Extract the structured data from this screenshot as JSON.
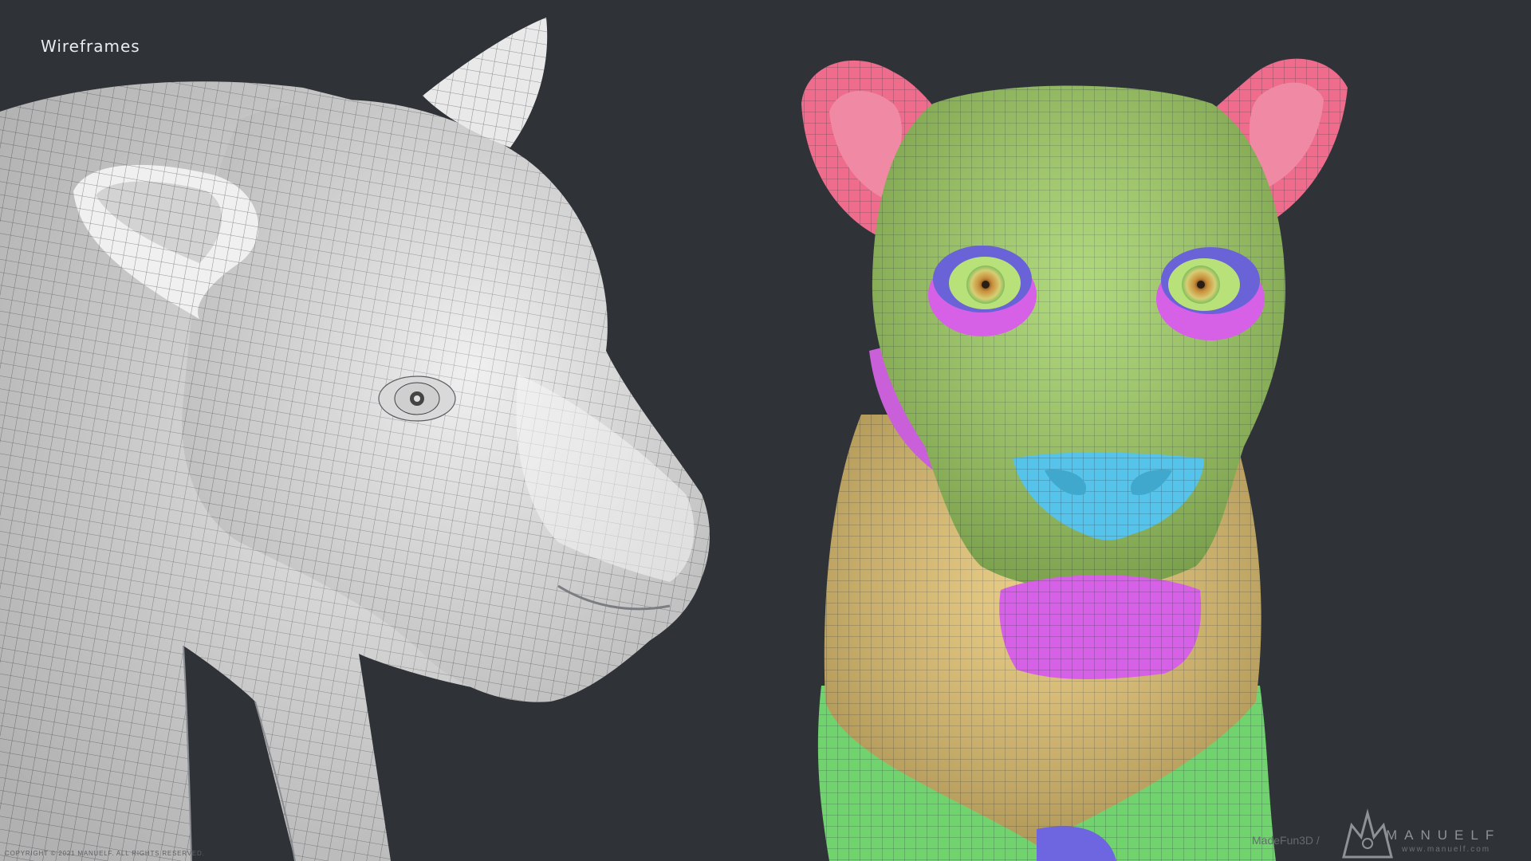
{
  "header": {
    "title": "Wireframes"
  },
  "footer": {
    "copyright": "COPYRIGHT © 2021 MANUELF. ALL RIGHTS RESERVED.",
    "credit": "MadeFun3D /",
    "brand": "MANUELF",
    "url": "www.manuelf.com"
  },
  "colors": {
    "background": "#2f3337",
    "mesh_white": "#e6e6e6",
    "mesh_green": "#9fd060",
    "mesh_pink": "#ef6c8c",
    "mesh_magenta": "#d660e6",
    "mesh_blue": "#7a6fe8",
    "mesh_cyan": "#55c3ea",
    "mesh_yellow": "#e6c46e",
    "mesh_light_green": "#71d36e"
  }
}
